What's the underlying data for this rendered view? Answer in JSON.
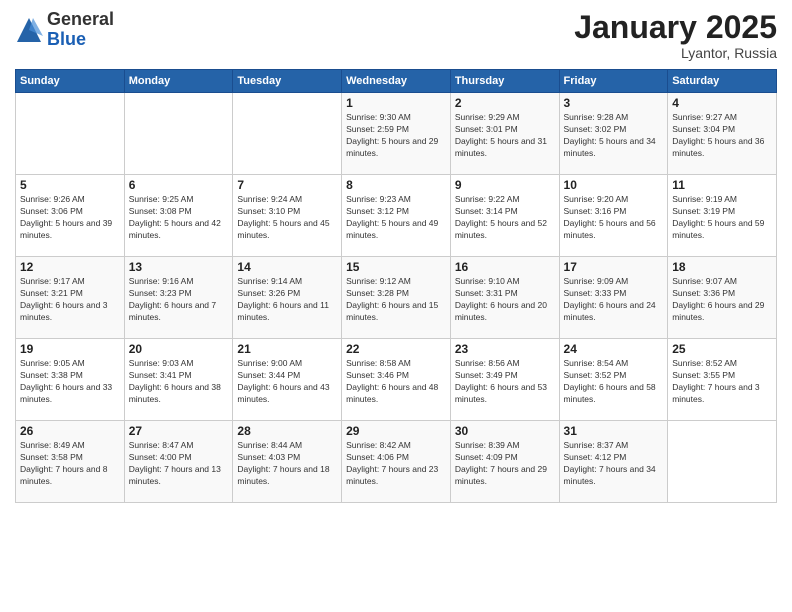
{
  "logo": {
    "general": "General",
    "blue": "Blue"
  },
  "header": {
    "month": "January 2025",
    "location": "Lyantor, Russia"
  },
  "weekdays": [
    "Sunday",
    "Monday",
    "Tuesday",
    "Wednesday",
    "Thursday",
    "Friday",
    "Saturday"
  ],
  "weeks": [
    [
      {
        "day": "",
        "info": ""
      },
      {
        "day": "",
        "info": ""
      },
      {
        "day": "",
        "info": ""
      },
      {
        "day": "1",
        "info": "Sunrise: 9:30 AM\nSunset: 2:59 PM\nDaylight: 5 hours and 29 minutes."
      },
      {
        "day": "2",
        "info": "Sunrise: 9:29 AM\nSunset: 3:01 PM\nDaylight: 5 hours and 31 minutes."
      },
      {
        "day": "3",
        "info": "Sunrise: 9:28 AM\nSunset: 3:02 PM\nDaylight: 5 hours and 34 minutes."
      },
      {
        "day": "4",
        "info": "Sunrise: 9:27 AM\nSunset: 3:04 PM\nDaylight: 5 hours and 36 minutes."
      }
    ],
    [
      {
        "day": "5",
        "info": "Sunrise: 9:26 AM\nSunset: 3:06 PM\nDaylight: 5 hours and 39 minutes."
      },
      {
        "day": "6",
        "info": "Sunrise: 9:25 AM\nSunset: 3:08 PM\nDaylight: 5 hours and 42 minutes."
      },
      {
        "day": "7",
        "info": "Sunrise: 9:24 AM\nSunset: 3:10 PM\nDaylight: 5 hours and 45 minutes."
      },
      {
        "day": "8",
        "info": "Sunrise: 9:23 AM\nSunset: 3:12 PM\nDaylight: 5 hours and 49 minutes."
      },
      {
        "day": "9",
        "info": "Sunrise: 9:22 AM\nSunset: 3:14 PM\nDaylight: 5 hours and 52 minutes."
      },
      {
        "day": "10",
        "info": "Sunrise: 9:20 AM\nSunset: 3:16 PM\nDaylight: 5 hours and 56 minutes."
      },
      {
        "day": "11",
        "info": "Sunrise: 9:19 AM\nSunset: 3:19 PM\nDaylight: 5 hours and 59 minutes."
      }
    ],
    [
      {
        "day": "12",
        "info": "Sunrise: 9:17 AM\nSunset: 3:21 PM\nDaylight: 6 hours and 3 minutes."
      },
      {
        "day": "13",
        "info": "Sunrise: 9:16 AM\nSunset: 3:23 PM\nDaylight: 6 hours and 7 minutes."
      },
      {
        "day": "14",
        "info": "Sunrise: 9:14 AM\nSunset: 3:26 PM\nDaylight: 6 hours and 11 minutes."
      },
      {
        "day": "15",
        "info": "Sunrise: 9:12 AM\nSunset: 3:28 PM\nDaylight: 6 hours and 15 minutes."
      },
      {
        "day": "16",
        "info": "Sunrise: 9:10 AM\nSunset: 3:31 PM\nDaylight: 6 hours and 20 minutes."
      },
      {
        "day": "17",
        "info": "Sunrise: 9:09 AM\nSunset: 3:33 PM\nDaylight: 6 hours and 24 minutes."
      },
      {
        "day": "18",
        "info": "Sunrise: 9:07 AM\nSunset: 3:36 PM\nDaylight: 6 hours and 29 minutes."
      }
    ],
    [
      {
        "day": "19",
        "info": "Sunrise: 9:05 AM\nSunset: 3:38 PM\nDaylight: 6 hours and 33 minutes."
      },
      {
        "day": "20",
        "info": "Sunrise: 9:03 AM\nSunset: 3:41 PM\nDaylight: 6 hours and 38 minutes."
      },
      {
        "day": "21",
        "info": "Sunrise: 9:00 AM\nSunset: 3:44 PM\nDaylight: 6 hours and 43 minutes."
      },
      {
        "day": "22",
        "info": "Sunrise: 8:58 AM\nSunset: 3:46 PM\nDaylight: 6 hours and 48 minutes."
      },
      {
        "day": "23",
        "info": "Sunrise: 8:56 AM\nSunset: 3:49 PM\nDaylight: 6 hours and 53 minutes."
      },
      {
        "day": "24",
        "info": "Sunrise: 8:54 AM\nSunset: 3:52 PM\nDaylight: 6 hours and 58 minutes."
      },
      {
        "day": "25",
        "info": "Sunrise: 8:52 AM\nSunset: 3:55 PM\nDaylight: 7 hours and 3 minutes."
      }
    ],
    [
      {
        "day": "26",
        "info": "Sunrise: 8:49 AM\nSunset: 3:58 PM\nDaylight: 7 hours and 8 minutes."
      },
      {
        "day": "27",
        "info": "Sunrise: 8:47 AM\nSunset: 4:00 PM\nDaylight: 7 hours and 13 minutes."
      },
      {
        "day": "28",
        "info": "Sunrise: 8:44 AM\nSunset: 4:03 PM\nDaylight: 7 hours and 18 minutes."
      },
      {
        "day": "29",
        "info": "Sunrise: 8:42 AM\nSunset: 4:06 PM\nDaylight: 7 hours and 23 minutes."
      },
      {
        "day": "30",
        "info": "Sunrise: 8:39 AM\nSunset: 4:09 PM\nDaylight: 7 hours and 29 minutes."
      },
      {
        "day": "31",
        "info": "Sunrise: 8:37 AM\nSunset: 4:12 PM\nDaylight: 7 hours and 34 minutes."
      },
      {
        "day": "",
        "info": ""
      }
    ]
  ]
}
